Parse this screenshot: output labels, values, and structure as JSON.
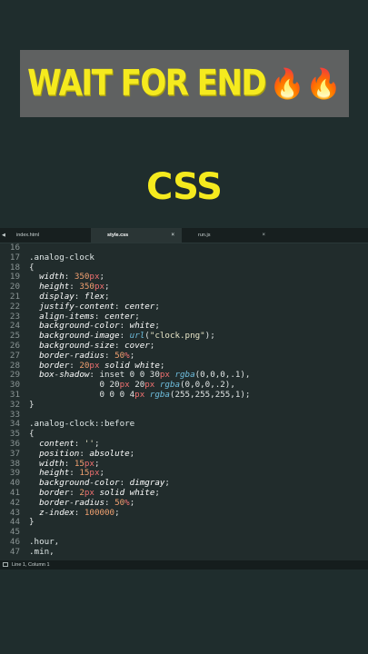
{
  "banner": {
    "text": "WAIT FOR END",
    "emoji": "🔥🔥"
  },
  "heading": "CSS",
  "tabs": [
    {
      "label": "index.html"
    },
    {
      "label": "style.css"
    },
    {
      "label": "run.js"
    }
  ],
  "tab_close": "×",
  "status": "Line 1, Column 1",
  "code": [
    {
      "n": "16",
      "parts": []
    },
    {
      "n": "17",
      "parts": [
        [
          "sel",
          ".analog-clock"
        ]
      ]
    },
    {
      "n": "18",
      "parts": [
        [
          "pun",
          "{"
        ]
      ]
    },
    {
      "n": "19",
      "parts": [
        [
          "pr",
          "  width"
        ],
        [
          "pun",
          ": "
        ],
        [
          "num",
          "350"
        ],
        [
          "unit",
          "px"
        ],
        [
          "pun",
          ";"
        ]
      ]
    },
    {
      "n": "20",
      "parts": [
        [
          "pr",
          "  height"
        ],
        [
          "pun",
          ": "
        ],
        [
          "num",
          "350"
        ],
        [
          "unit",
          "px"
        ],
        [
          "pun",
          ";"
        ]
      ]
    },
    {
      "n": "21",
      "parts": [
        [
          "pr",
          "  display"
        ],
        [
          "pun",
          ": "
        ],
        [
          "val",
          "flex"
        ],
        [
          "pun",
          ";"
        ]
      ]
    },
    {
      "n": "22",
      "parts": [
        [
          "pr",
          "  justify-content"
        ],
        [
          "pun",
          ": "
        ],
        [
          "val",
          "center"
        ],
        [
          "pun",
          ";"
        ]
      ]
    },
    {
      "n": "23",
      "parts": [
        [
          "pr",
          "  align-items"
        ],
        [
          "pun",
          ": "
        ],
        [
          "val",
          "center"
        ],
        [
          "pun",
          ";"
        ]
      ]
    },
    {
      "n": "24",
      "parts": [
        [
          "pr",
          "  background-color"
        ],
        [
          "pun",
          ": "
        ],
        [
          "val",
          "white"
        ],
        [
          "pun",
          ";"
        ]
      ]
    },
    {
      "n": "25",
      "parts": [
        [
          "pr",
          "  background-image"
        ],
        [
          "pun",
          ": "
        ],
        [
          "fn",
          "url"
        ],
        [
          "pun",
          "("
        ],
        [
          "str",
          "\"clock.png\""
        ],
        [
          "pun",
          ");"
        ]
      ]
    },
    {
      "n": "26",
      "parts": [
        [
          "pr",
          "  background-size"
        ],
        [
          "pun",
          ": "
        ],
        [
          "val",
          "cover"
        ],
        [
          "pun",
          ";"
        ]
      ]
    },
    {
      "n": "27",
      "parts": [
        [
          "pr",
          "  border-radius"
        ],
        [
          "pun",
          ": "
        ],
        [
          "num",
          "50"
        ],
        [
          "unit",
          "%"
        ],
        [
          "pun",
          ";"
        ]
      ]
    },
    {
      "n": "28",
      "parts": [
        [
          "pr",
          "  border"
        ],
        [
          "pun",
          ": "
        ],
        [
          "num",
          "20"
        ],
        [
          "unit",
          "px"
        ],
        [
          "val",
          " solid white"
        ],
        [
          "pun",
          ";"
        ]
      ]
    },
    {
      "n": "29",
      "parts": [
        [
          "pr",
          "  box-shadow"
        ],
        [
          "pun",
          ": "
        ],
        [
          "pun",
          "inset 0 0 30"
        ],
        [
          "unit",
          "px"
        ],
        [
          "fn",
          " rgba"
        ],
        [
          "pun",
          "(0,0,0,.1),"
        ]
      ]
    },
    {
      "n": "30",
      "parts": [
        [
          "pun",
          "              0 20"
        ],
        [
          "unit",
          "px"
        ],
        [
          "pun",
          " 20"
        ],
        [
          "unit",
          "px"
        ],
        [
          "fn",
          " rgba"
        ],
        [
          "pun",
          "(0,0,0,.2),"
        ]
      ]
    },
    {
      "n": "31",
      "parts": [
        [
          "pun",
          "              0 0 0 4"
        ],
        [
          "unit",
          "px"
        ],
        [
          "fn",
          " rgba"
        ],
        [
          "pun",
          "(255,255,255,1);"
        ]
      ]
    },
    {
      "n": "32",
      "parts": [
        [
          "pun",
          "}"
        ]
      ]
    },
    {
      "n": "33",
      "parts": []
    },
    {
      "n": "34",
      "parts": [
        [
          "sel",
          ".analog-clock::before"
        ]
      ]
    },
    {
      "n": "35",
      "parts": [
        [
          "pun",
          "{"
        ]
      ]
    },
    {
      "n": "36",
      "parts": [
        [
          "pr",
          "  content"
        ],
        [
          "pun",
          ": "
        ],
        [
          "str",
          "''"
        ],
        [
          "pun",
          ";"
        ]
      ]
    },
    {
      "n": "37",
      "parts": [
        [
          "pr",
          "  position"
        ],
        [
          "pun",
          ": "
        ],
        [
          "val",
          "absolute"
        ],
        [
          "pun",
          ";"
        ]
      ]
    },
    {
      "n": "38",
      "parts": [
        [
          "pr",
          "  width"
        ],
        [
          "pun",
          ": "
        ],
        [
          "num",
          "15"
        ],
        [
          "unit",
          "px"
        ],
        [
          "pun",
          ";"
        ]
      ]
    },
    {
      "n": "39",
      "parts": [
        [
          "pr",
          "  height"
        ],
        [
          "pun",
          ": "
        ],
        [
          "num",
          "15"
        ],
        [
          "unit",
          "px"
        ],
        [
          "pun",
          ";"
        ]
      ]
    },
    {
      "n": "40",
      "parts": [
        [
          "pr",
          "  background-color"
        ],
        [
          "pun",
          ": "
        ],
        [
          "val",
          "dimgray"
        ],
        [
          "pun",
          ";"
        ]
      ]
    },
    {
      "n": "41",
      "parts": [
        [
          "pr",
          "  border"
        ],
        [
          "pun",
          ": "
        ],
        [
          "num",
          "2"
        ],
        [
          "unit",
          "px"
        ],
        [
          "val",
          " solid white"
        ],
        [
          "pun",
          ";"
        ]
      ]
    },
    {
      "n": "42",
      "parts": [
        [
          "pr",
          "  border-radius"
        ],
        [
          "pun",
          ": "
        ],
        [
          "num",
          "50"
        ],
        [
          "unit",
          "%"
        ],
        [
          "pun",
          ";"
        ]
      ]
    },
    {
      "n": "43",
      "parts": [
        [
          "pr",
          "  z-index"
        ],
        [
          "pun",
          ": "
        ],
        [
          "num",
          "100000"
        ],
        [
          "pun",
          ";"
        ]
      ]
    },
    {
      "n": "44",
      "parts": [
        [
          "pun",
          "}"
        ]
      ]
    },
    {
      "n": "45",
      "parts": []
    },
    {
      "n": "46",
      "parts": [
        [
          "sel",
          ".hour"
        ],
        [
          "pun",
          ","
        ]
      ]
    },
    {
      "n": "47",
      "parts": [
        [
          "sel",
          ".min"
        ],
        [
          "pun",
          ","
        ]
      ]
    }
  ]
}
